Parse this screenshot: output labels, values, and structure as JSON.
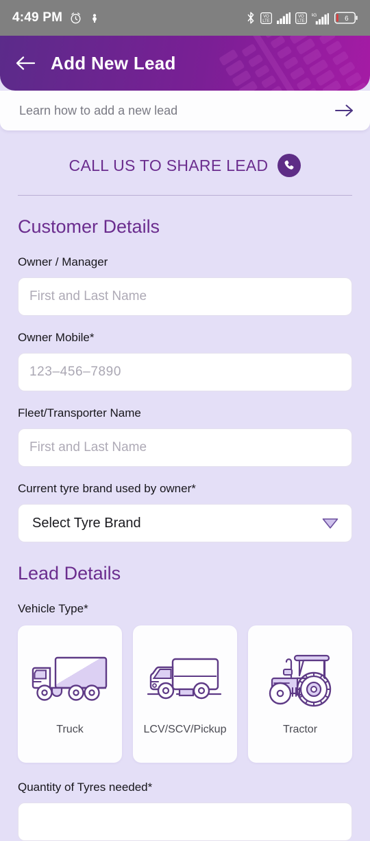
{
  "statusbar": {
    "time": "4:49 PM",
    "battery_level": "6",
    "network_label": "4G",
    "volte_label_1": "VO\nLTE",
    "volte_label_2": "VO\nLTE",
    "icons": [
      "alarm-icon",
      "vibrate-icon",
      "bluetooth-icon",
      "volte-icon",
      "signal-icon",
      "volte-icon",
      "4g-signal-icon",
      "battery-icon"
    ]
  },
  "appbar": {
    "title": "Add New Lead",
    "back_icon": "arrow-left-icon",
    "gradient_start": "#5B2B8A",
    "gradient_end": "#A51BA5"
  },
  "learn_card": {
    "text": "Learn how to add a new lead",
    "arrow_icon": "arrow-right-icon"
  },
  "call_banner": {
    "label": "CALL US TO SHARE LEAD",
    "icon": "phone-icon",
    "accent": "#5E2D86"
  },
  "customer_details": {
    "heading": "Customer Details",
    "fields": [
      {
        "label": "Owner / Manager",
        "placeholder": "First and Last Name",
        "value": ""
      },
      {
        "label": "Owner Mobile*",
        "placeholder": "123–456–7890",
        "value": ""
      },
      {
        "label": "Fleet/Transporter Name",
        "placeholder": "First and Last Name",
        "value": ""
      }
    ],
    "tyre_brand": {
      "label": "Current tyre brand used by owner*",
      "selected": "Select Tyre Brand",
      "chevron_icon": "chevron-down-icon"
    }
  },
  "lead_details": {
    "heading": "Lead Details",
    "vehicle_type": {
      "label": "Vehicle Type*",
      "options": [
        {
          "label": "Truck",
          "icon": "truck-icon"
        },
        {
          "label": "LCV/SCV/Pickup",
          "icon": "pickup-truck-icon"
        },
        {
          "label": "Tractor",
          "icon": "tractor-icon"
        }
      ]
    },
    "quantity": {
      "label": "Quantity of Tyres needed*"
    }
  },
  "theme": {
    "background": "#E4DFF7",
    "primary_purple": "#6B2D8E",
    "icon_stroke": "#5E3A86",
    "icon_fill": "#DDD3F2"
  }
}
